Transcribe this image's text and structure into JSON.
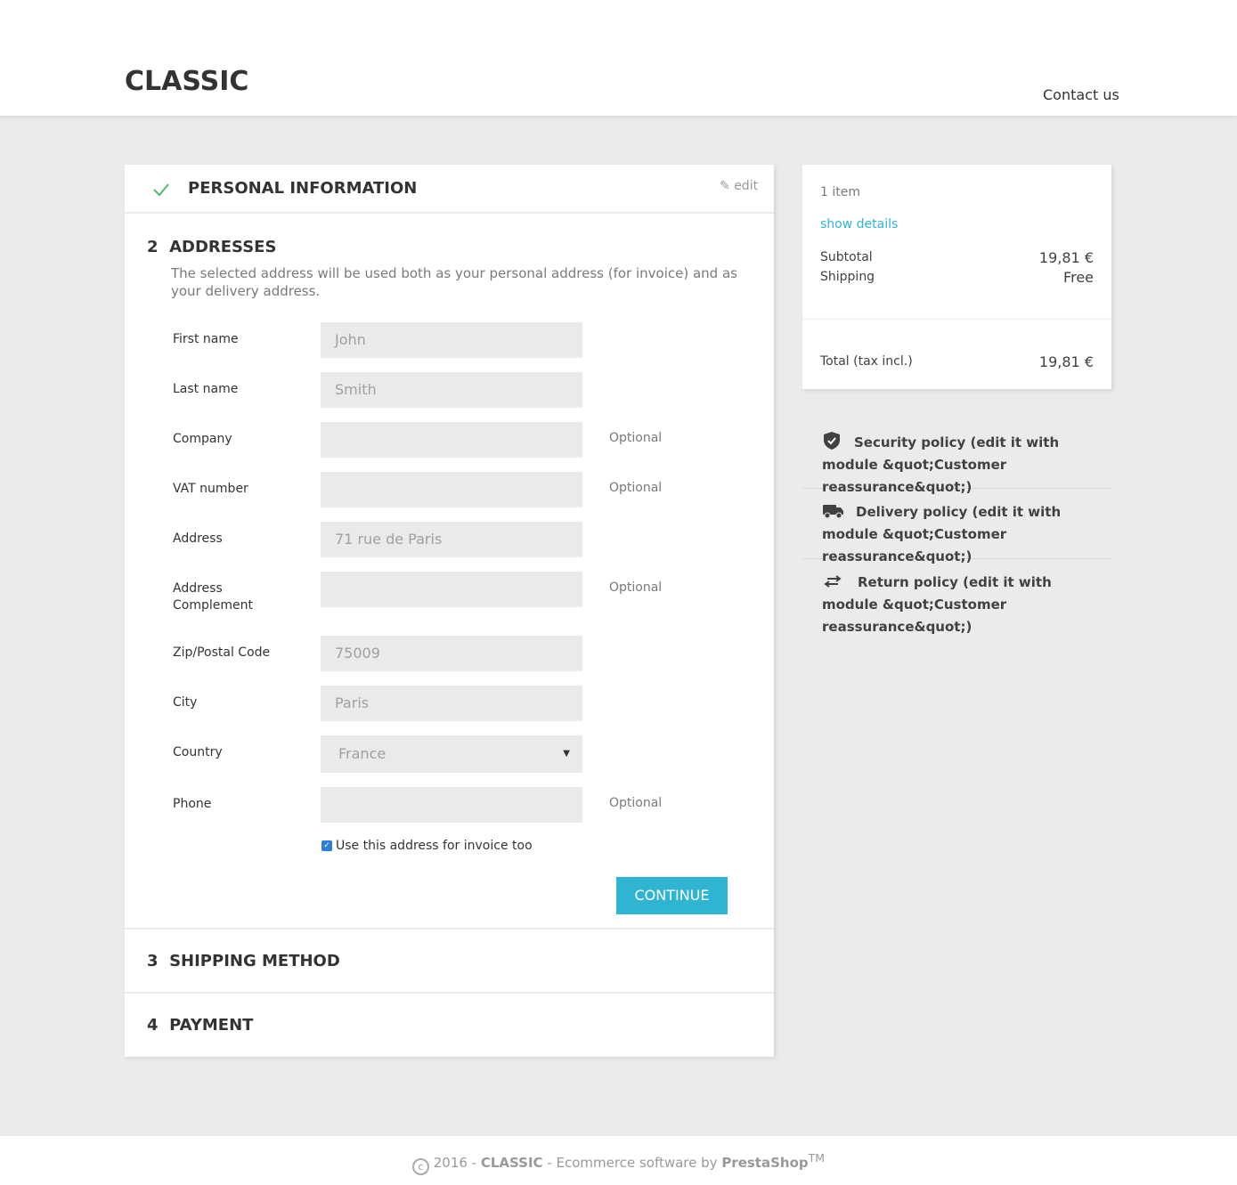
{
  "header": {
    "logo": "CLASSIC",
    "contact": "Contact us"
  },
  "steps": {
    "personal": {
      "title": "PERSONAL INFORMATION",
      "edit": "edit",
      "status_icon": "check-icon",
      "accent": "#4cbb6c"
    },
    "addresses": {
      "number": "2",
      "title": "ADDRESSES",
      "description": "The selected address will be used both as your personal address (for invoice) and as your delivery address."
    },
    "shipping": {
      "number": "3",
      "title": "SHIPPING METHOD"
    },
    "payment": {
      "number": "4",
      "title": "PAYMENT"
    }
  },
  "form": {
    "fields": [
      {
        "label": "First name",
        "value": "John",
        "optional": ""
      },
      {
        "label": "Last name",
        "value": "Smith",
        "optional": ""
      },
      {
        "label": "Company",
        "value": "",
        "optional": "Optional"
      },
      {
        "label": "VAT number",
        "value": "",
        "optional": "Optional"
      },
      {
        "label": "Address",
        "value": "71 rue de Paris",
        "optional": ""
      },
      {
        "label": "Address Complement",
        "value": "",
        "optional": "Optional"
      },
      {
        "label": "Zip/Postal Code",
        "value": "75009",
        "optional": ""
      },
      {
        "label": "City",
        "value": "Paris",
        "optional": ""
      },
      {
        "label": "Country",
        "value": "France",
        "optional": ""
      },
      {
        "label": "Phone",
        "value": "",
        "optional": "Optional"
      }
    ],
    "invoice_checkbox": {
      "label": "Use this address for invoice too",
      "checked": true
    },
    "continue": "CONTINUE",
    "button_color": "#2fb5d2"
  },
  "summary": {
    "items": "1 item",
    "show_details": "show details",
    "subtotal_label": "Subtotal",
    "subtotal": "19,81 €",
    "shipping_label": "Shipping",
    "shipping": "Free",
    "total_label": "Total (tax incl.)",
    "total": "19,81 €"
  },
  "reassurance": [
    {
      "icon": "shield-check-icon",
      "text": "Security policy (edit it with module &quot;Customer reassurance&quot;)"
    },
    {
      "icon": "truck-icon",
      "text": "Delivery policy (edit it with module &quot;Customer reassurance&quot;)"
    },
    {
      "icon": "exchange-arrows-icon",
      "text": "Return policy (edit it with module &quot;Customer reassurance&quot;)"
    }
  ],
  "footer": {
    "year": "2016 - ",
    "brand": "CLASSIC",
    "middle": " - Ecommerce software by ",
    "company": "PrestaShop",
    "tm": "TM"
  }
}
